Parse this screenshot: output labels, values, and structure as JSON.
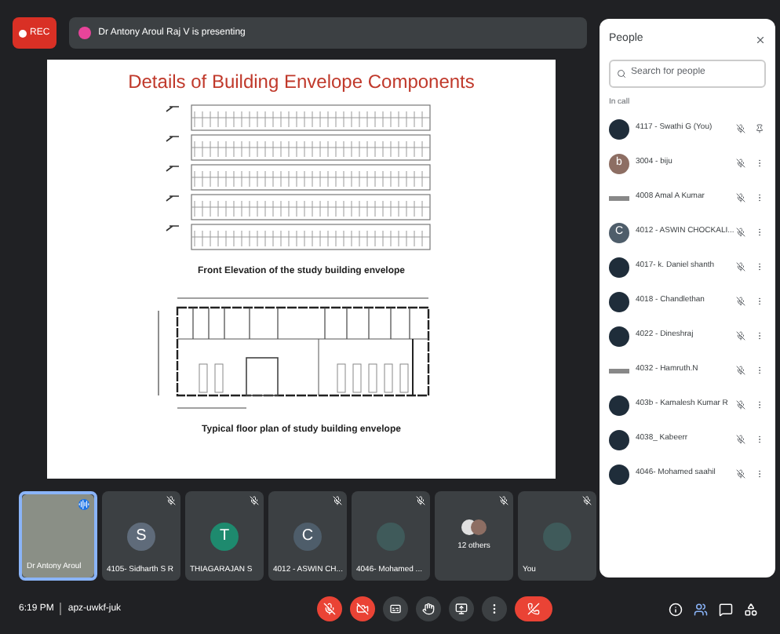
{
  "top_bar": {
    "rec_label": "REC",
    "presenting": "Dr Antony Aroul Raj V is presenting"
  },
  "slide": {
    "title": "Details of Building Envelope Components",
    "captions": [
      "Front Elevation of the study building envelope",
      "Typical floor plan of study building envelope"
    ]
  },
  "tiles": [
    {
      "kind": "video",
      "name": "Dr Antony Aroul",
      "speaking": true
    },
    {
      "kind": "letter",
      "letter": "S",
      "name": "4105- Sidharth S R",
      "color": "#5f6b7a",
      "speaking": false
    },
    {
      "kind": "letter",
      "letter": "T",
      "name": "THIAGARAJAN S",
      "color": "#1e8a6e",
      "speaking": false
    },
    {
      "kind": "letter",
      "letter": "C",
      "name": "4012 - ASWIN CH...",
      "color": "#4e5d6a",
      "speaking": false
    },
    {
      "kind": "photo",
      "name": "4046- Mohamed ...",
      "speaking": false
    },
    {
      "kind": "group",
      "name": "12 others",
      "speaking": false
    },
    {
      "kind": "photo",
      "name": "You",
      "speaking": false
    }
  ],
  "people": {
    "title": "People",
    "search": {
      "placeholder": "Search for people"
    },
    "section": "In call",
    "items": [
      {
        "name": "4117 - Swathi G (You)",
        "kind": "photo",
        "self": true
      },
      {
        "name": "3004 - biju",
        "kind": "letter",
        "letter": "b",
        "color": "#8d6e63",
        "self": false
      },
      {
        "name": "4008 Amal A Kumar",
        "kind": "logo",
        "self": false
      },
      {
        "name": "4012 - ASWIN CHOCKALI...",
        "kind": "letter",
        "letter": "C",
        "color": "#4e5d6a",
        "self": false
      },
      {
        "name": "4017- k. Daniel shanth",
        "kind": "photo",
        "self": false
      },
      {
        "name": "4018 - Chandlethan",
        "kind": "photo",
        "self": false
      },
      {
        "name": "4022 - Dineshraj",
        "kind": "photo",
        "self": false
      },
      {
        "name": "4032 - Hamruth.N",
        "kind": "logo",
        "self": false
      },
      {
        "name": "403b - Kamalesh Kumar R",
        "kind": "photo",
        "self": false
      },
      {
        "name": "4038_ Kabeerr",
        "kind": "photo",
        "self": false
      },
      {
        "name": "4046- Mohamed saahil",
        "kind": "photo",
        "self": false
      }
    ]
  },
  "bottom_bar": {
    "time": "6:19 PM",
    "meeting_code": "apz-uwkf-juk",
    "controls": [
      {
        "kind": "mic",
        "off": true
      },
      {
        "kind": "camera",
        "off": true
      },
      {
        "kind": "captions",
        "off": false
      },
      {
        "kind": "hand",
        "off": false
      },
      {
        "kind": "present",
        "off": false
      },
      {
        "kind": "more",
        "off": false
      },
      {
        "kind": "end",
        "off": true
      }
    ]
  }
}
